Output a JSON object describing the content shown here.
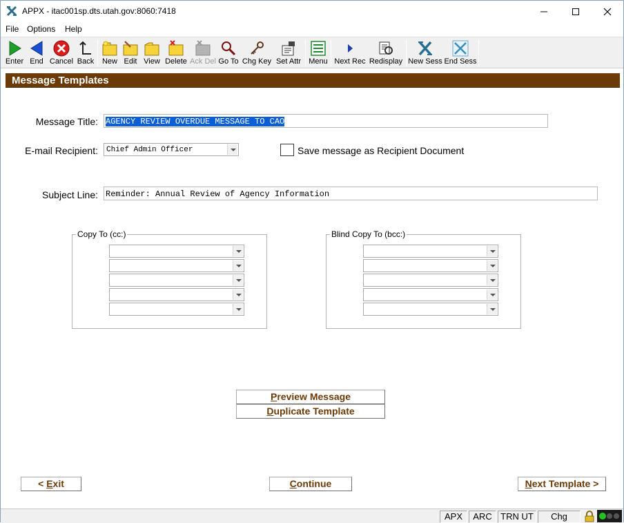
{
  "window": {
    "title": "APPX - itac001sp.dts.utah.gov:8060:7418",
    "minimize_glyph": "—",
    "maximize_glyph": "☐",
    "close_glyph": "✕"
  },
  "menu": {
    "items": [
      "File",
      "Options",
      "Help"
    ]
  },
  "toolbar": {
    "buttons": [
      {
        "label": "Enter",
        "icon": "green-play-icon",
        "disabled": false
      },
      {
        "label": "End",
        "icon": "blue-back-arrow-icon",
        "disabled": false
      },
      {
        "label": "Cancel",
        "icon": "red-cancel-icon",
        "disabled": false
      },
      {
        "label": "Back",
        "icon": "back-arrow-icon",
        "disabled": false
      },
      {
        "label": "New",
        "icon": "new-folder-icon",
        "disabled": false
      },
      {
        "label": "Edit",
        "icon": "edit-folder-icon",
        "disabled": false
      },
      {
        "label": "View",
        "icon": "view-folder-icon",
        "disabled": false
      },
      {
        "label": "Delete",
        "icon": "delete-folder-icon",
        "disabled": false
      },
      {
        "label": "Ack Del",
        "icon": "ack-delete-icon",
        "disabled": true
      },
      {
        "label": "Go To",
        "icon": "magnifier-icon",
        "disabled": false
      },
      {
        "label": "Chg Key",
        "icon": "key-icon",
        "disabled": false
      },
      {
        "label": "Set Attr",
        "icon": "set-attributes-icon",
        "disabled": false
      },
      {
        "label": "Menu",
        "icon": "menu-list-icon",
        "disabled": false
      },
      {
        "label": "Next Rec",
        "icon": "next-record-icon",
        "disabled": false
      },
      {
        "label": "Redisplay",
        "icon": "redisplay-icon",
        "disabled": false
      },
      {
        "label": "New Sess",
        "icon": "new-session-icon",
        "disabled": false
      },
      {
        "label": "End Sess",
        "icon": "end-session-icon",
        "disabled": false
      }
    ]
  },
  "form": {
    "page_title": "Message Templates",
    "message_title_label": "Message Title:",
    "message_title_value": "AGENCY REVIEW OVERDUE MESSAGE TO CAO",
    "email_recipient_label": "E-mail Recipient:",
    "email_recipient_value": "Chief Admin Officer",
    "save_recipient_doc_label": "Save message as Recipient Document",
    "save_recipient_doc_checked": false,
    "subject_line_label": "Subject Line:",
    "subject_line_value": "Reminder: Annual Review of Agency Information",
    "cc_group_label": "Copy To (cc:)",
    "bcc_group_label": "Blind Copy To (bcc:)",
    "cc_values": [
      "",
      "",
      "",
      "",
      ""
    ],
    "bcc_values": [
      "",
      "",
      "",
      "",
      ""
    ],
    "preview_button": {
      "accel": "P",
      "rest": "review Message"
    },
    "duplicate_button": {
      "accel": "D",
      "rest": "uplicate Template"
    },
    "exit_button": {
      "pre": "< ",
      "accel": "E",
      "rest": "xit"
    },
    "continue_button": {
      "accel": "C",
      "rest": "ontinue"
    },
    "next_template_button": {
      "accel": "N",
      "rest": "ext Template >"
    }
  },
  "status": {
    "cells": [
      "APX",
      "ARC",
      "TRN UT",
      "Chg"
    ],
    "lock_icon": "lock-icon",
    "lights_icon": "status-lights-icon"
  }
}
